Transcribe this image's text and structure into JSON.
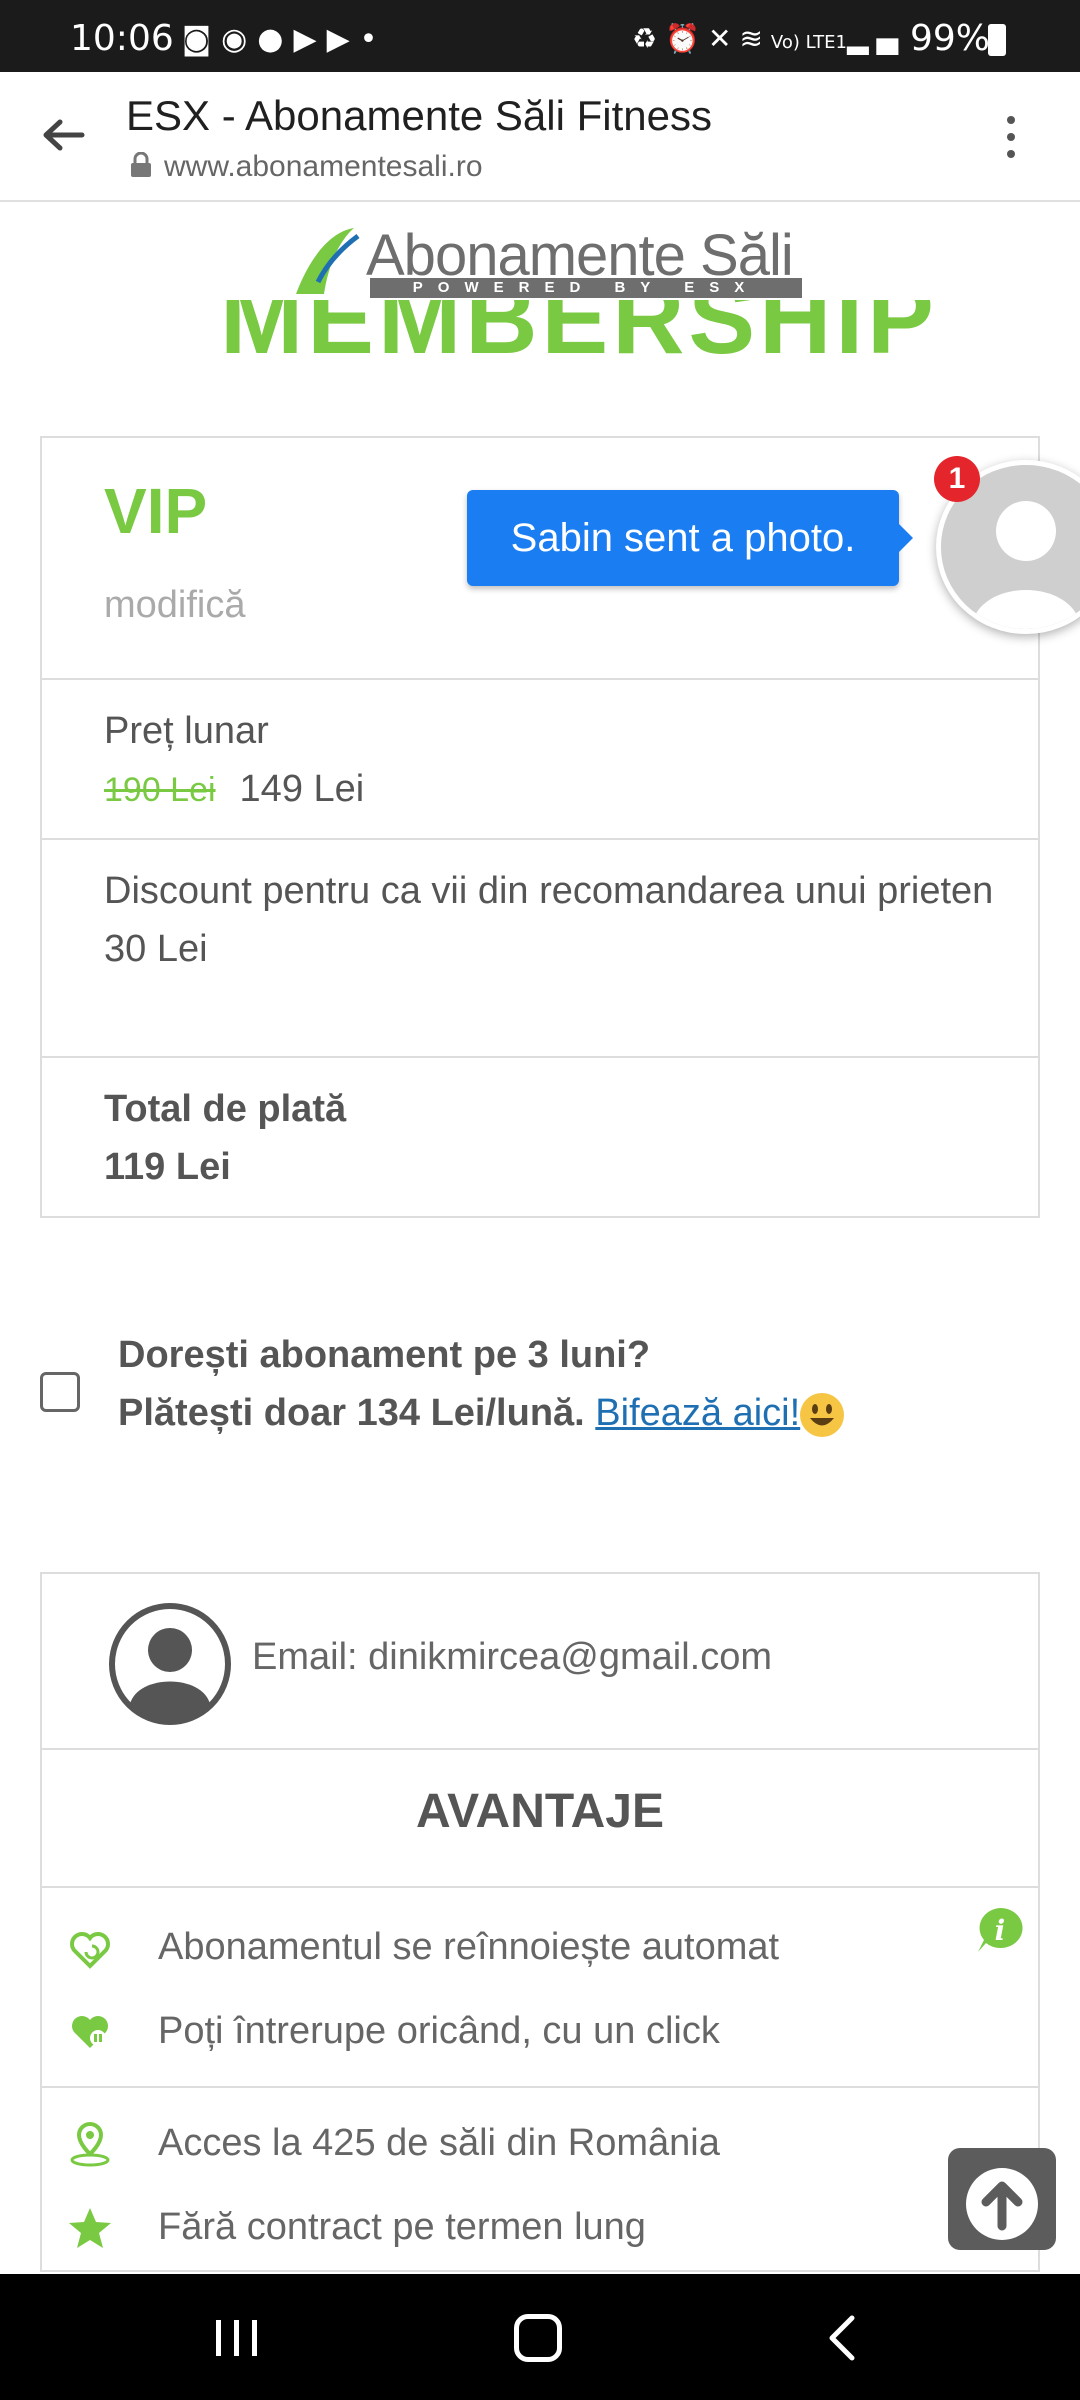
{
  "status_bar": {
    "time": "10:06",
    "left_icons": [
      "discord-icon",
      "messenger-icon",
      "facebook-icon",
      "youtube-icon",
      "youtube-icon",
      "dot-icon"
    ],
    "right_icons": [
      "recycle-icon",
      "alarm-icon",
      "mute-icon",
      "wifi-icon",
      "volte-icon",
      "signal-icon"
    ],
    "volte_label": "Vo) LTE1",
    "battery": "99%"
  },
  "browser": {
    "title": "ESX - Abonamente Săli Fitness",
    "url": "www.abonamentesali.ro"
  },
  "logo": {
    "name": "Abonamente Săli",
    "tagline": "POWERED BY ESX"
  },
  "section_heading_partial": "MEMBERSHIP",
  "plan": {
    "name": "VIP",
    "modify_label": "modifică",
    "monthly_price_label": "Preț lunar",
    "old_price": "190 Lei",
    "new_price": "149 Lei",
    "discount_label": "Discount pentru ca vii din recomandarea unui prieten",
    "discount_value": "30 Lei",
    "total_label": "Total de plată",
    "total_value": "119 Lei"
  },
  "three_month_offer": {
    "line1": "Dorești abonament pe 3 luni?",
    "line2": "Plătești doar 134 Lei/lună.",
    "link": "Bifează aici!",
    "checked": false
  },
  "account": {
    "email_text": "Email: dinikmircea@gmail.com"
  },
  "advantages": {
    "heading": "AVANTAJE",
    "items": [
      "Abonamentul se reînnoiește automat",
      "Poți întrerupe oricând, cu un click",
      "Acces la 425 de săli din România",
      "Fără contract pe termen lung"
    ]
  },
  "chat_notification": {
    "message": "Sabin sent a photo.",
    "badge_count": "1"
  },
  "colors": {
    "brand_green": "#7ac943",
    "bubble_blue": "#1a7ef2",
    "badge_red": "#e4262c",
    "link_blue": "#1f6fb3"
  }
}
